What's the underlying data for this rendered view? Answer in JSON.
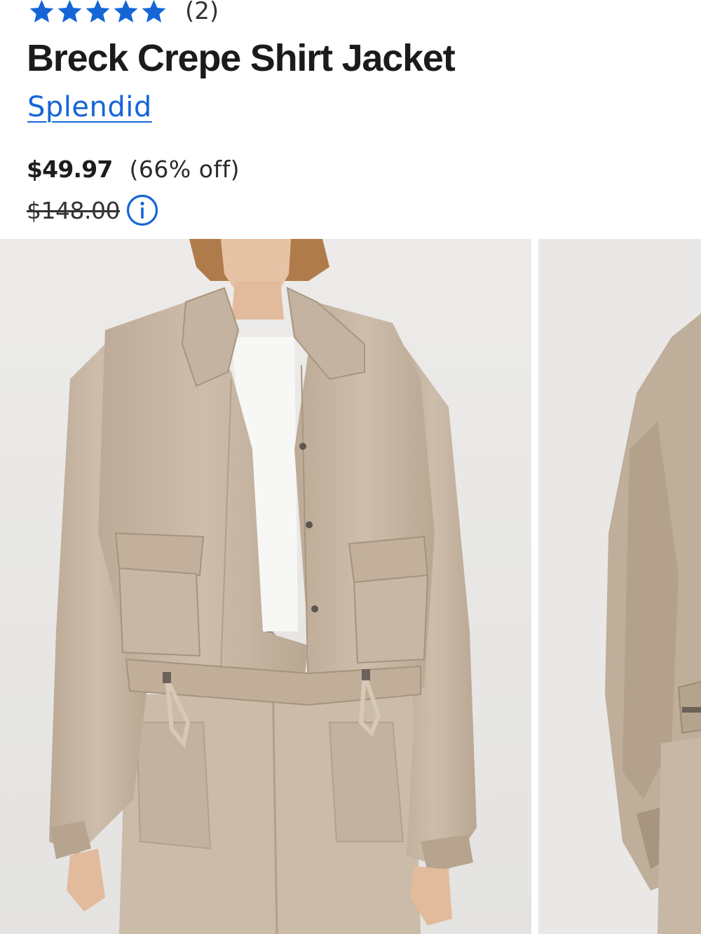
{
  "product": {
    "rating": {
      "stars": 5,
      "max": 5,
      "review_count": "(2)"
    },
    "title": "Breck Crepe Shirt Jacket",
    "brand": "Splendid",
    "price": {
      "sale": "$49.97",
      "discount": "(66% off)",
      "original": "$148.00"
    }
  },
  "icons": {
    "star": "star-icon",
    "info": "info-icon"
  },
  "colors": {
    "star": "#1565d6",
    "link": "#1565d6",
    "info": "#1565d6",
    "jacket": "#c8b8a6",
    "background": "#e9e8e6"
  },
  "gallery": {
    "images": [
      {
        "subject": "model wearing beige crepe shirt jacket, front view"
      },
      {
        "subject": "model wearing beige crepe shirt jacket, side view"
      }
    ]
  }
}
